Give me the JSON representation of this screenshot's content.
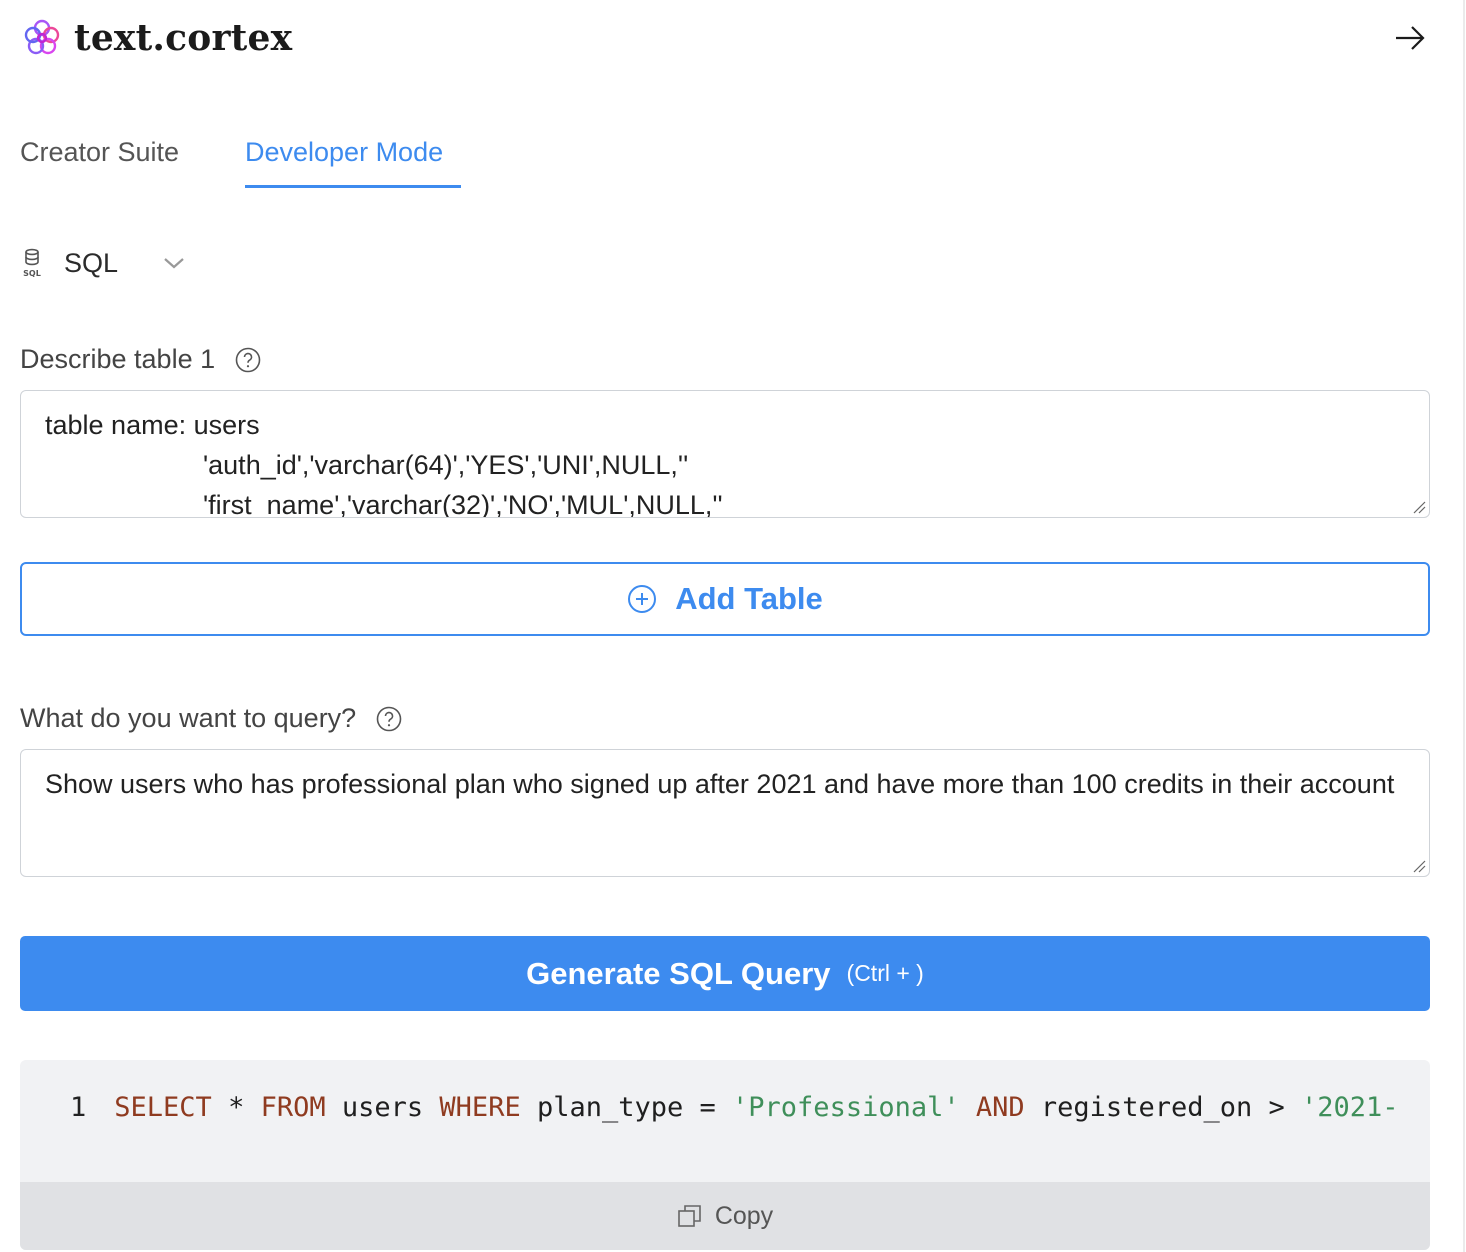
{
  "brand": {
    "name": "text.cortex"
  },
  "header": {
    "collapse_icon": "arrow-right-icon"
  },
  "tabs": [
    {
      "label": "Creator Suite",
      "active": false
    },
    {
      "label": "Developer Mode",
      "active": true
    }
  ],
  "language": {
    "icon": "sql-database-icon",
    "selected": "SQL"
  },
  "table_section": {
    "label": "Describe table 1",
    "lines": [
      "table name: users",
      "'auth_id','varchar(64)','YES','UNI',NULL,''",
      "'first_name','varchar(32)','NO','MUL',NULL,''"
    ]
  },
  "add_table": {
    "label": "Add Table"
  },
  "query_section": {
    "label": "What do you want to query?",
    "value": "Show users who has professional plan who signed up after 2021 and have more than 100 credits in their account"
  },
  "generate": {
    "label": "Generate SQL Query",
    "shortcut": "(Ctrl + )"
  },
  "code": {
    "line_number": "1",
    "tokens": {
      "t1": "SELECT",
      "t2": " * ",
      "t3": "FROM",
      "t4": " users ",
      "t5": "WHERE",
      "t6": " plan_type = ",
      "t7": "'Professional'",
      "t8": " ",
      "t9": "AND",
      "t10": " registered_on > ",
      "t11": "'2021-"
    }
  },
  "copy": {
    "label": "Copy"
  },
  "colors": {
    "accent": "#3d8bef",
    "keyword": "#8f3b20",
    "string": "#3f8f5a"
  }
}
